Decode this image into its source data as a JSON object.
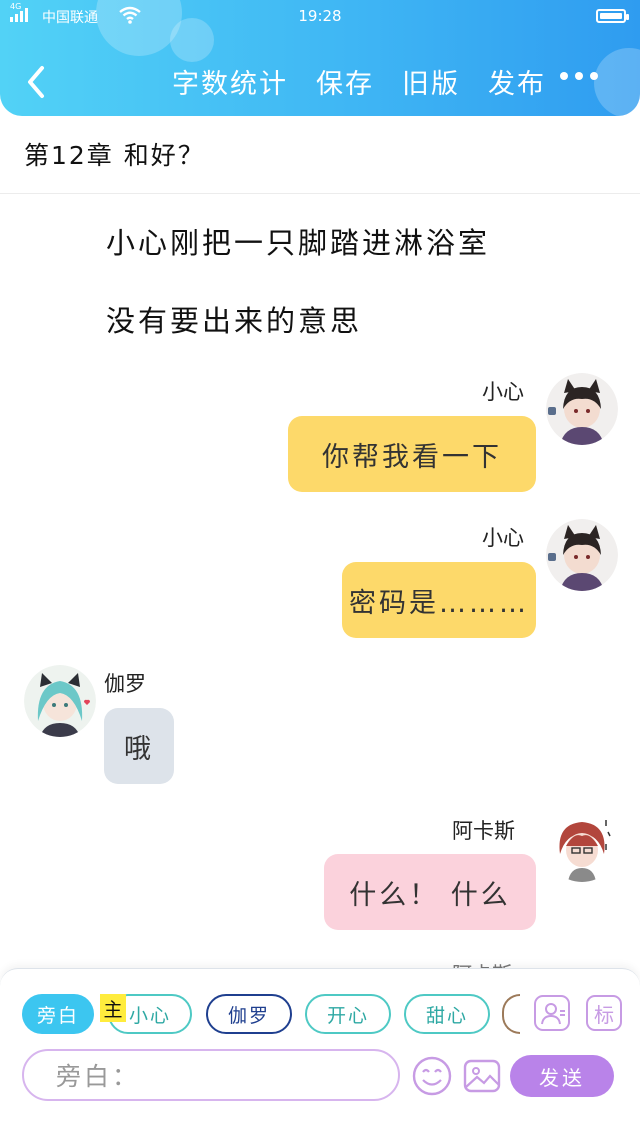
{
  "status_bar": {
    "network": "4G",
    "carrier": "中国联通",
    "time": "19:28"
  },
  "header": {
    "actions": [
      "字数统计",
      "保存",
      "旧版",
      "发布"
    ]
  },
  "chapter_title": "第12章 和好？",
  "narration": [
    "小心刚把一只脚踏进淋浴室",
    "没有要出来的意思"
  ],
  "messages": [
    {
      "name": "小心",
      "text": "你帮我看一下",
      "side": "right",
      "bubble_color": "#fdd96a"
    },
    {
      "name": "小心",
      "text": "密码是………",
      "side": "right",
      "bubble_color": "#fdd96a"
    },
    {
      "name": "伽罗",
      "text": "哦",
      "side": "left",
      "bubble_color": "#dde3ea"
    },
    {
      "name": "阿卡斯",
      "text": "什么！ 什么",
      "side": "right",
      "bubble_color": "#fbd2dc"
    }
  ],
  "peek_name": "阿卡斯",
  "composer": {
    "chips": [
      {
        "label": "旁白",
        "selected": true,
        "color": "#3cc6f0"
      },
      {
        "label": "小心",
        "selected": false,
        "color": "#4ec9c4"
      },
      {
        "label": "伽罗",
        "selected": false,
        "color": "#1f3f8f"
      },
      {
        "label": "开心",
        "selected": false,
        "color": "#4ec9c4"
      },
      {
        "label": "甜心",
        "selected": false,
        "color": "#4ec9c4"
      }
    ],
    "main_tag": "主",
    "label_icon": "标",
    "input_placeholder": "旁白：",
    "send_label": "发送"
  },
  "colors": {
    "header_start": "#52d2f6",
    "header_end": "#2f9cf0",
    "accent_purple": "#b983e9"
  }
}
